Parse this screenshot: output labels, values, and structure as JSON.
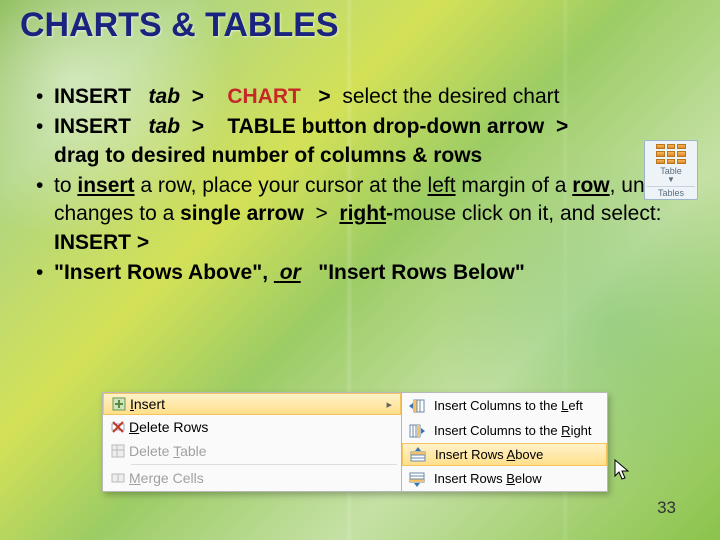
{
  "slide": {
    "title": "CHARTS & TABLES",
    "page_number": "33",
    "bullets": {
      "b1": {
        "insert": "INSERT",
        "tab": "tab",
        "gt1": ">",
        "chart": "CHART",
        "gt2": ">",
        "rest": "select the desired chart"
      },
      "b2": {
        "insert": "INSERT",
        "tab": "tab",
        "gt1": ">",
        "table_btn": "TABLE button drop-down arrow",
        "gt2": ">",
        "line2": "drag to desired number of columns & rows"
      },
      "b3": {
        "pre": " to ",
        "insert_word": "insert",
        "mid1": " a row, place your cursor at the ",
        "left_word": "left",
        "mid2": " margin of a ",
        "row_word": "row",
        "mid3": ", until it changes to a ",
        "single_arrow": "single arrow",
        "gt": ">",
        "right_word": "right",
        "dash": "-",
        "tail": "mouse click on it, and select: ",
        "insert_caps": "INSERT >"
      },
      "b4": {
        "q1": "\"Insert Rows Above\"",
        "comma": ",",
        "or": "or",
        "q2": "\"Insert Rows Below\""
      }
    }
  },
  "table_button": {
    "label": "Table",
    "sub": "Tables"
  },
  "context_menu_left": {
    "items": [
      {
        "icon": "insert-icon",
        "label": "Insert",
        "underline": "I",
        "hl": true,
        "arrow": true
      },
      {
        "icon": "delete-rows-icon",
        "label": "Delete Rows",
        "underline": "D"
      },
      {
        "icon": "delete-table-icon",
        "label": "Delete Table",
        "underline": "T",
        "disabled": true
      },
      {
        "sep": true
      },
      {
        "icon": "merge-cells-icon",
        "label": "Merge Cells",
        "underline": "M",
        "disabled": true
      }
    ]
  },
  "context_menu_right": {
    "items": [
      {
        "icon": "insert-col-left-icon",
        "label_pre": "Insert Columns to the ",
        "label_u": "L",
        "label_post": "eft"
      },
      {
        "icon": "insert-col-right-icon",
        "label_pre": "Insert Columns to the ",
        "label_u": "R",
        "label_post": "ight"
      },
      {
        "icon": "insert-row-above-icon",
        "label_pre": "Insert Rows ",
        "label_u": "A",
        "label_post": "bove",
        "hl": true
      },
      {
        "icon": "insert-row-below-icon",
        "label_pre": "Insert Rows ",
        "label_u": "B",
        "label_post": "elow"
      }
    ]
  }
}
